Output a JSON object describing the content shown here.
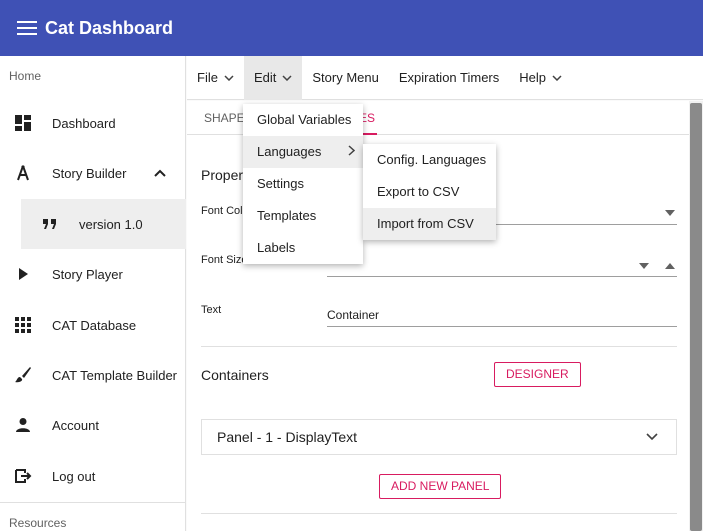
{
  "app": {
    "title": "Cat Dashboard"
  },
  "sidebar": {
    "home_section": "Home",
    "items": [
      {
        "label": "Dashboard",
        "icon": "dashboard-icon"
      },
      {
        "label": "Story Builder",
        "icon": "story-builder-icon"
      },
      {
        "label": "version 1.0",
        "icon": "quote-icon"
      },
      {
        "label": "Story Player",
        "icon": "play-icon"
      },
      {
        "label": "CAT Database",
        "icon": "grid-icon"
      },
      {
        "label": "CAT Template Builder",
        "icon": "brush-icon"
      },
      {
        "label": "Account",
        "icon": "person-icon"
      },
      {
        "label": "Log out",
        "icon": "logout-icon"
      }
    ],
    "resources_section": "Resources"
  },
  "menubar": {
    "items": [
      "File",
      "Edit",
      "Story Menu",
      "Expiration Timers",
      "Help"
    ]
  },
  "edit_menu": {
    "items": [
      "Global Variables",
      "Languages",
      "Settings",
      "Templates",
      "Labels"
    ]
  },
  "languages_menu": {
    "items": [
      "Config. Languages",
      "Export to CSV",
      "Import from CSV"
    ]
  },
  "tabs": {
    "shapes": "SHAPES",
    "active_tail": "ES"
  },
  "properties": {
    "title_partial": "Proper",
    "font_color_label": "Font Colo",
    "font_size_label": "Font Size",
    "text_label": "Text",
    "text_value": "Container"
  },
  "containers": {
    "title": "Containers",
    "designer_button": "DESIGNER",
    "panel_label": "Panel - 1 - DisplayText",
    "add_panel_button": "ADD NEW PANEL"
  },
  "colors": {
    "primary": "#3f51b5",
    "accent": "#d81b60"
  }
}
